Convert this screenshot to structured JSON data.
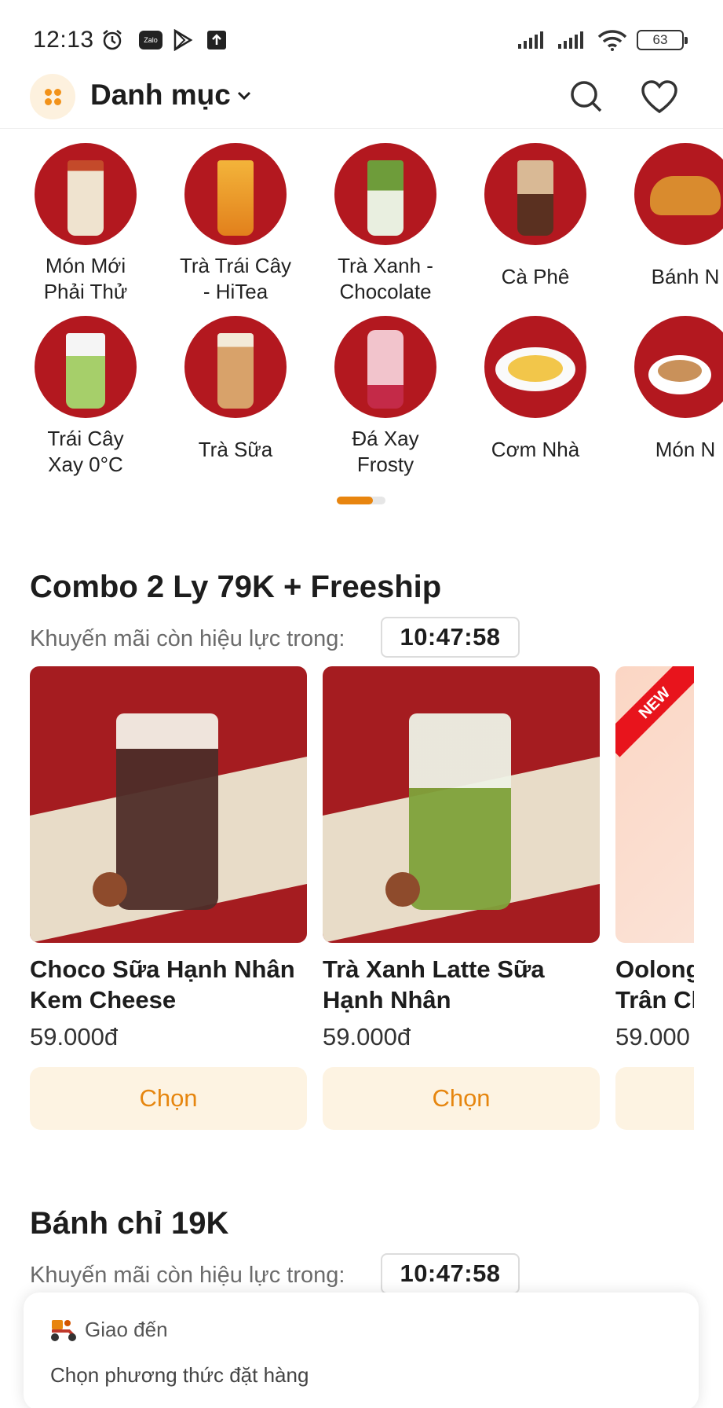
{
  "status": {
    "time": "12:13",
    "app_badge": "Zalo",
    "battery": "63"
  },
  "header": {
    "title": "Danh mục"
  },
  "categories": [
    {
      "label": "Món Mới\nPhải Thử"
    },
    {
      "label": "Trà Trái Cây\n- HiTea"
    },
    {
      "label": "Trà Xanh -\nChocolate"
    },
    {
      "label": "Cà Phê"
    },
    {
      "label": "Bánh N"
    },
    {
      "label": "Trái Cây\nXay 0°C"
    },
    {
      "label": "Trà Sữa"
    },
    {
      "label": "Đá Xay\nFrosty"
    },
    {
      "label": "Cơm Nhà"
    },
    {
      "label": "Món N"
    }
  ],
  "sections": [
    {
      "title": "Combo 2 Ly 79K + Freeship",
      "countdown_label": "Khuyến mãi còn hiệu lực trong:",
      "countdown": "10:47:58",
      "products": [
        {
          "name": "Choco Sữa Hạnh Nhân\nKem Cheese",
          "price": "59.000đ",
          "button": "Chọn"
        },
        {
          "name": "Trà Xanh Latte Sữa\nHạnh Nhân",
          "price": "59.000đ",
          "button": "Chọn"
        },
        {
          "name": "Oolong\nTrân Ch",
          "price": "59.000",
          "button": "",
          "badge": "NEW"
        }
      ]
    },
    {
      "title": "Bánh chỉ 19K",
      "countdown_label": "Khuyến mãi còn hiệu lực trong:",
      "countdown": "10:47:58"
    }
  ],
  "delivery": {
    "title": "Giao đến",
    "subtitle": "Chọn phương thức đặt hàng"
  },
  "colors": {
    "brand": "#e8850f",
    "brand_light": "#fdf3e2",
    "circle_red": "#b3181f"
  }
}
